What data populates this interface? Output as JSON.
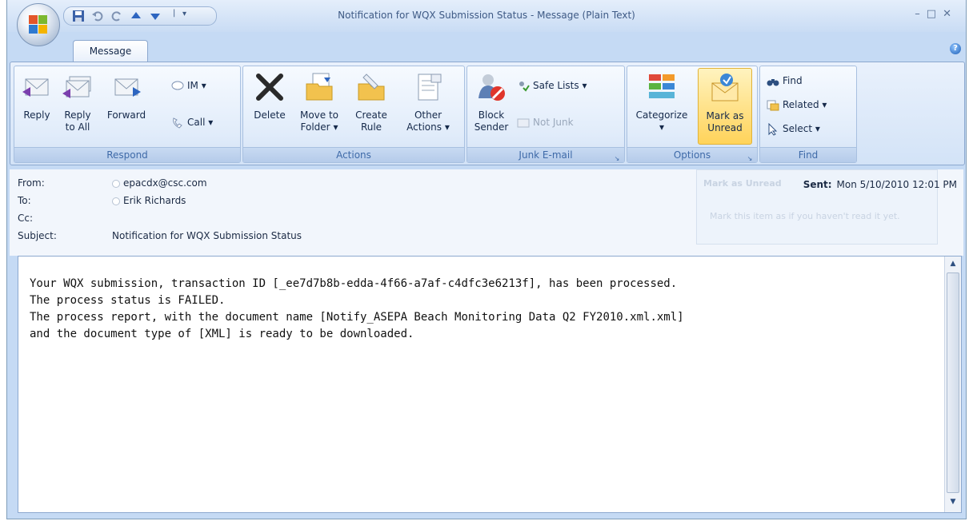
{
  "window": {
    "title": "Notification for WQX Submission Status - Message (Plain Text)"
  },
  "tabs": [
    {
      "label": "Message"
    }
  ],
  "ribbon": {
    "respond": {
      "label": "Respond",
      "reply": "Reply",
      "reply_all_1": "Reply",
      "reply_all_2": "to All",
      "forward": "Forward",
      "im": "IM",
      "call": "Call"
    },
    "actions": {
      "label": "Actions",
      "delete": "Delete",
      "move_1": "Move to",
      "move_2": "Folder",
      "create_1": "Create",
      "create_2": "Rule",
      "other_1": "Other",
      "other_2": "Actions"
    },
    "junk": {
      "label": "Junk E-mail",
      "block_1": "Block",
      "block_2": "Sender",
      "safe_lists": "Safe Lists",
      "not_junk": "Not Junk"
    },
    "options": {
      "label": "Options",
      "categorize": "Categorize",
      "mark_1": "Mark as",
      "mark_2": "Unread"
    },
    "find": {
      "label": "Find",
      "find": "Find",
      "related": "Related",
      "select": "Select"
    }
  },
  "header": {
    "from_label": "From:",
    "from_value": "epacdx@csc.com",
    "to_label": "To:",
    "to_value": "Erik Richards",
    "cc_label": "Cc:",
    "subject_label": "Subject:",
    "subject_value": "Notification for WQX Submission Status",
    "sent_label": "Sent:",
    "sent_value": "Mon 5/10/2010 12:01 PM",
    "tooltip_title": "Mark as Unread",
    "tooltip_text": "Mark this item as if you haven't read it yet."
  },
  "body": {
    "text": "Your WQX submission, transaction ID [_ee7d7b8b-edda-4f66-a7af-c4dfc3e6213f], has been processed.\nThe process status is FAILED.\nThe process report, with the document name [Notify_ASEPA Beach Monitoring Data Q2 FY2010.xml.xml]\nand the document type of [XML] is ready to be downloaded."
  }
}
